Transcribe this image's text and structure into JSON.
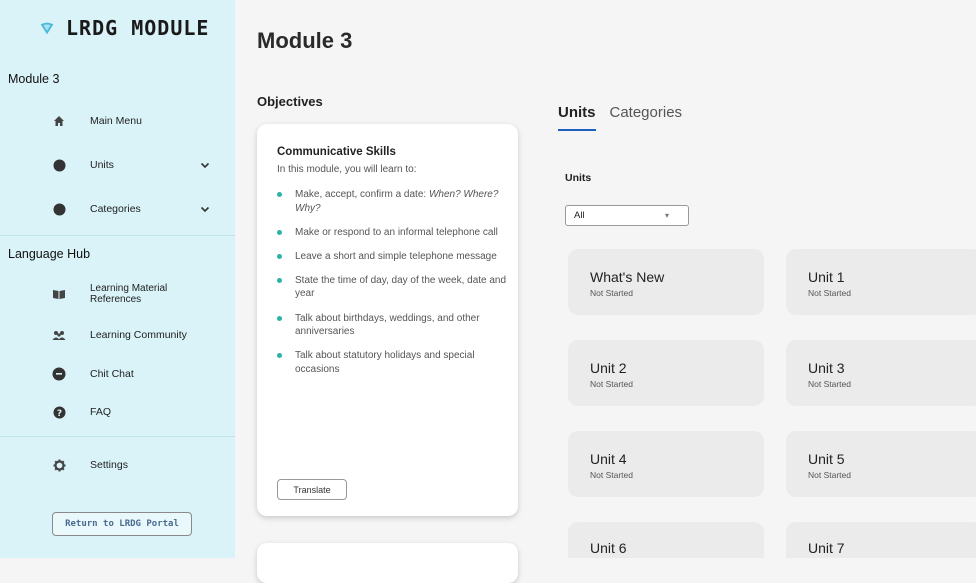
{
  "brand": {
    "title": "LRDG MODULE",
    "logo_icon": "lrdg-logo-icon",
    "accent": "#4ab8d8"
  },
  "sidebar": {
    "module_heading": "Module 3",
    "module_items": [
      {
        "label": "Main Menu",
        "icon": "home-icon"
      },
      {
        "label": "Units",
        "icon": "circle-icon"
      },
      {
        "label": "Categories",
        "icon": "circle-icon"
      }
    ],
    "hub_heading": "Language Hub",
    "hub_items": [
      {
        "label": "Learning Material References",
        "label_line1": "Learning Material",
        "label_line2": "References",
        "icon": "book-icon"
      },
      {
        "label": "Learning Community",
        "icon": "people-icon"
      },
      {
        "label": "Chit Chat",
        "icon": "chat-bubble-icon"
      },
      {
        "label": "FAQ",
        "icon": "help-icon"
      }
    ],
    "settings_label": "Settings",
    "portal_button": "Return to LRDG Portal"
  },
  "main": {
    "title": "Module 3",
    "objectives_heading": "Objectives",
    "objective_card": {
      "title": "Communicative Skills",
      "intro": "In this module, you will learn to:",
      "items": [
        "Make, accept, confirm a date: When? Where? Why?",
        "Make or respond to an informal telephone call",
        "Leave a short and simple telephone message",
        "State the time of day, day of the week, date and year",
        "Talk about birthdays, weddings, and other anniversaries",
        "Talk about statutory holidays and special occasions"
      ],
      "translate_label": "Translate"
    },
    "tabs": [
      {
        "label": "Units",
        "active": true
      },
      {
        "label": "Categories",
        "active": false
      }
    ],
    "units_filter": {
      "label": "Units",
      "selected": "All"
    },
    "units": [
      {
        "name": "What's New",
        "status": "Not Started"
      },
      {
        "name": "Unit 1",
        "status": "Not Started"
      },
      {
        "name": "Unit 2",
        "status": "Not Started"
      },
      {
        "name": "Unit 3",
        "status": "Not Started"
      },
      {
        "name": "Unit 4",
        "status": "Not Started"
      },
      {
        "name": "Unit 5",
        "status": "Not Started"
      },
      {
        "name": "Unit 6",
        "status": ""
      },
      {
        "name": "Unit 7",
        "status": ""
      }
    ]
  },
  "colors": {
    "sidebar_bg": "#d9f3f8",
    "tab_underline": "#1f5fbf",
    "bullet": "#2ab3a6",
    "card_bg": "#ebebeb"
  }
}
